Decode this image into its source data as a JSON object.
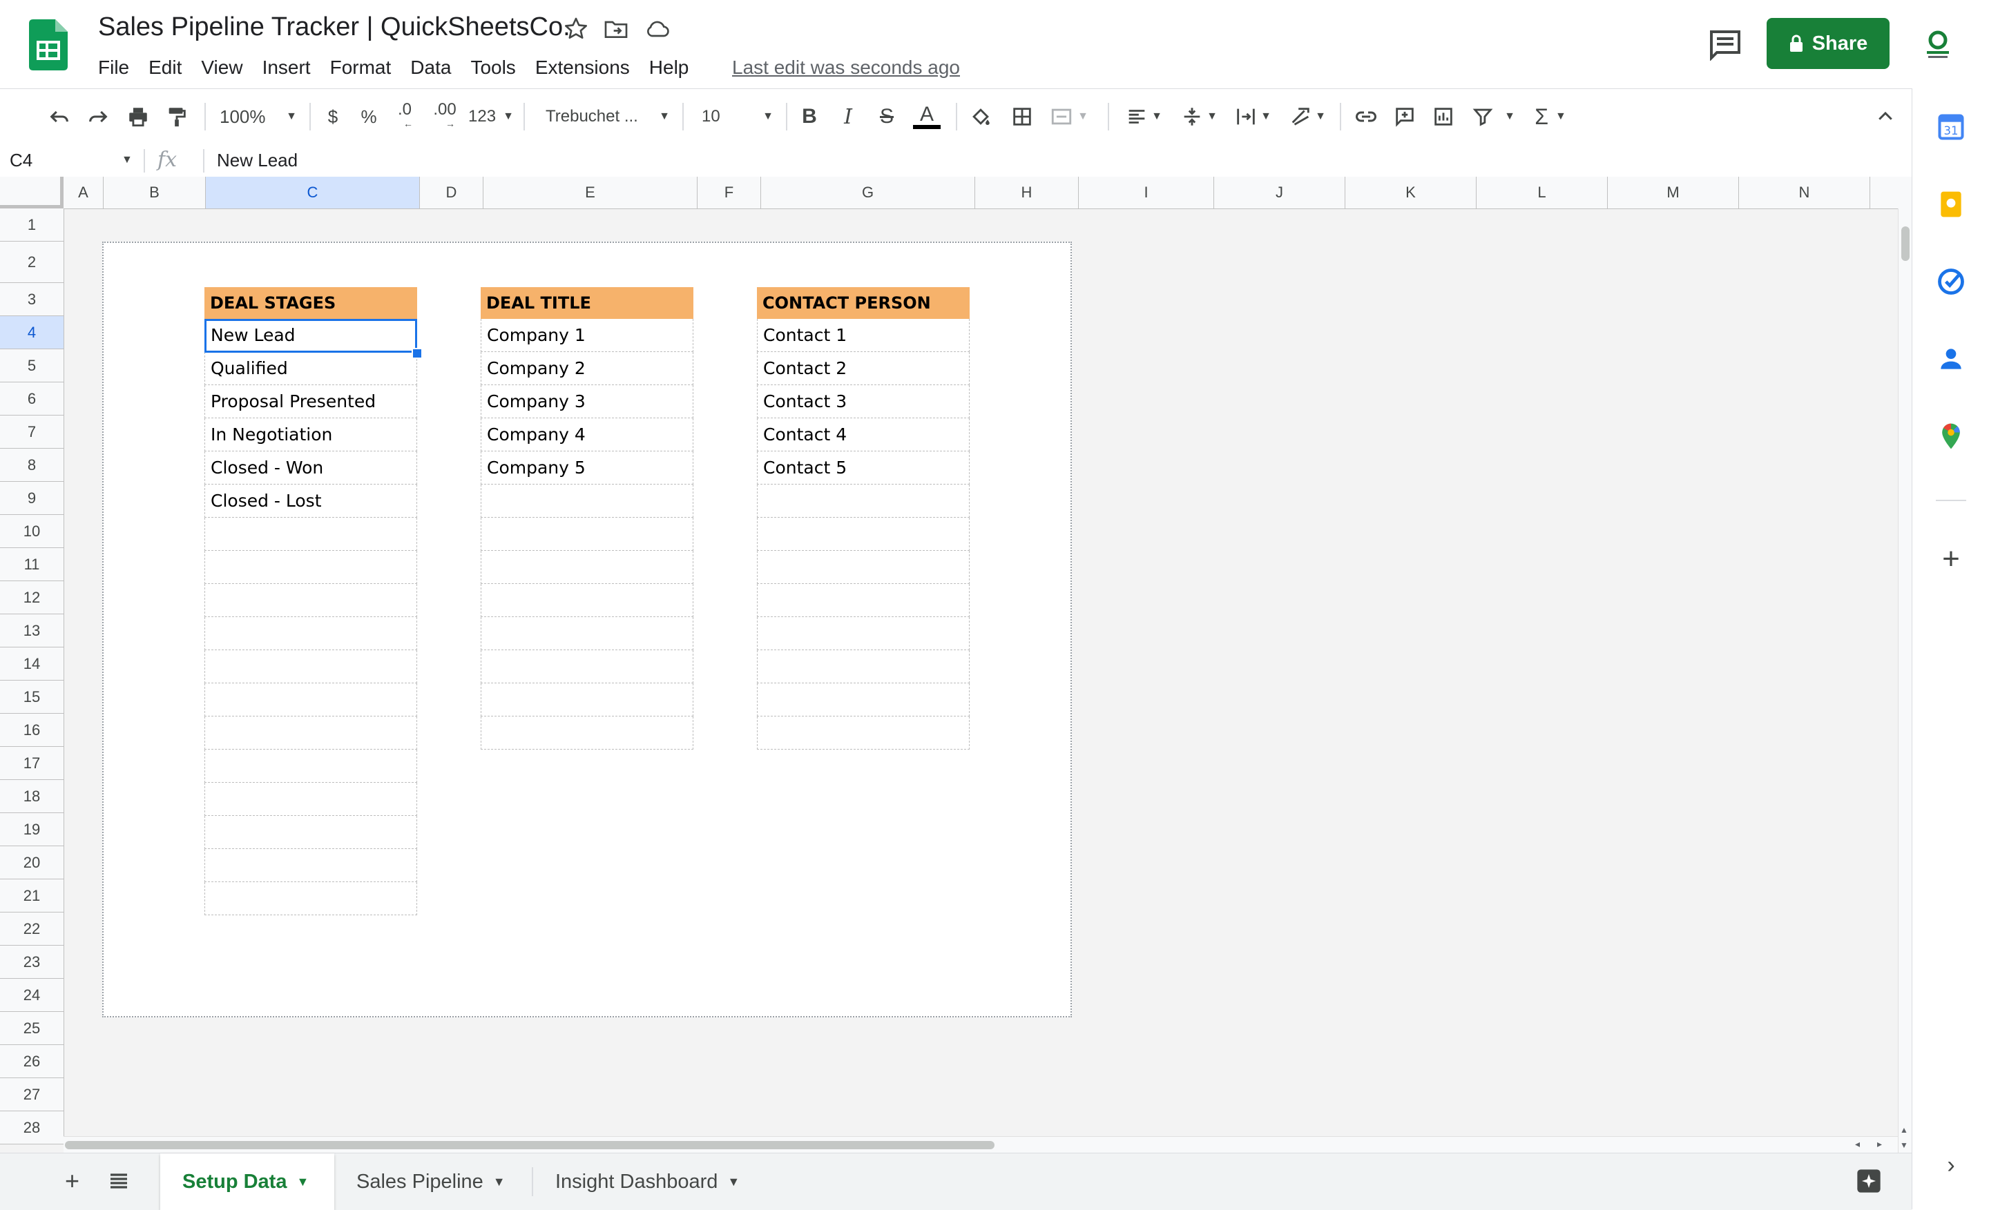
{
  "header": {
    "doc_title": "Sales Pipeline Tracker | QuickSheetsCo.",
    "last_edit": "Last edit was seconds ago",
    "share_label": "Share",
    "menu": [
      "File",
      "Edit",
      "View",
      "Insert",
      "Format",
      "Data",
      "Tools",
      "Extensions",
      "Help"
    ]
  },
  "toolbar": {
    "zoom": "100%",
    "currency": "$",
    "percent": "%",
    "decrease_decimal": ".0",
    "increase_decimal": ".00",
    "more_formats": "123",
    "font": "Trebuchet ...",
    "font_size": "10"
  },
  "formula_bar": {
    "cell_ref": "C4",
    "fx": "fx",
    "value": "New Lead"
  },
  "grid": {
    "columns": [
      "A",
      "B",
      "C",
      "D",
      "E",
      "F",
      "G",
      "H",
      "I",
      "J",
      "K",
      "L",
      "M",
      "N"
    ],
    "selected_column": "C",
    "rows": [
      "1",
      "2",
      "3",
      "4",
      "5",
      "6",
      "7",
      "8",
      "9",
      "10",
      "11",
      "12",
      "13",
      "14",
      "15",
      "16",
      "17",
      "18",
      "19",
      "20",
      "21",
      "22",
      "23",
      "24",
      "25",
      "26",
      "27",
      "28"
    ],
    "selected_row": "4"
  },
  "tables": {
    "deal_stages": {
      "header": "DEAL STAGES",
      "cells": [
        "New Lead",
        "Qualified",
        "Proposal Presented",
        "In Negotiation",
        "Closed - Won",
        "Closed - Lost",
        "",
        "",
        "",
        "",
        "",
        "",
        "",
        "",
        "",
        "",
        "",
        ""
      ]
    },
    "deal_title": {
      "header": "DEAL TITLE",
      "cells": [
        "Company 1",
        "Company 2",
        "Company 3",
        "Company 4",
        "Company 5",
        "",
        "",
        "",
        "",
        "",
        "",
        "",
        ""
      ]
    },
    "contact_person": {
      "header": "CONTACT PERSON",
      "cells": [
        "Contact 1",
        "Contact 2",
        "Contact 3",
        "Contact 4",
        "Contact 5",
        "",
        "",
        "",
        "",
        "",
        "",
        "",
        ""
      ]
    }
  },
  "sheet_tabs": [
    "Setup Data",
    "Sales Pipeline",
    "Insight Dashboard"
  ],
  "active_tab": "Setup Data",
  "colors": {
    "header_fill": "#f6b26b",
    "share_green": "#188038",
    "selection_blue": "#1a73e8"
  }
}
